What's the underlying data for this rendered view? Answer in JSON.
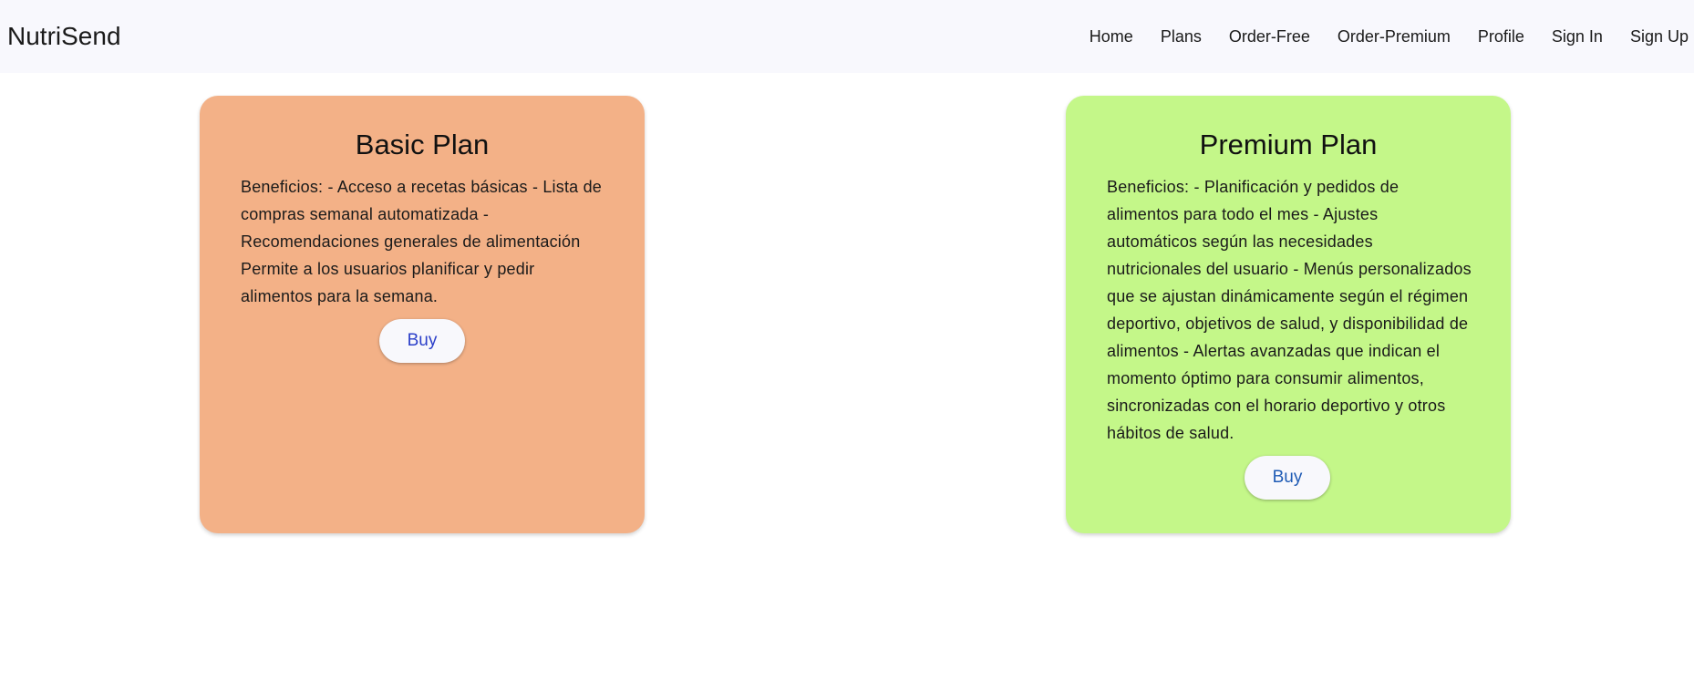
{
  "header": {
    "brand": "NutriSend",
    "nav": [
      "Home",
      "Plans",
      "Order-Free",
      "Order-Premium",
      "Profile",
      "Sign In",
      "Sign Up"
    ]
  },
  "plans": [
    {
      "title": "Basic Plan",
      "description": "Beneficios: - Acceso a recetas básicas - Lista de compras semanal automatizada - Recomendaciones generales de alimentación Permite a los usuarios planificar y pedir alimentos para la semana.",
      "button_label": "Buy",
      "background": "#f3b187",
      "button_text_color": "#2b3fc9"
    },
    {
      "title": "Premium Plan",
      "description": "Beneficios: - Planificación y pedidos de alimentos para todo el mes - Ajustes automáticos según las necesidades nutricionales del usuario - Menús personalizados que se ajustan dinámicamente según el régimen deportivo, objetivos de salud, y disponibilidad de alimentos - Alertas avanzadas que indican el momento óptimo para consumir alimentos, sincronizadas con el horario deportivo y otros hábitos de salud.",
      "button_label": "Buy",
      "background": "#c4f789",
      "button_text_color": "#1f5bb5"
    }
  ],
  "colors": {
    "header_background": "#f8f8fd",
    "page_background": "#ffffff"
  }
}
